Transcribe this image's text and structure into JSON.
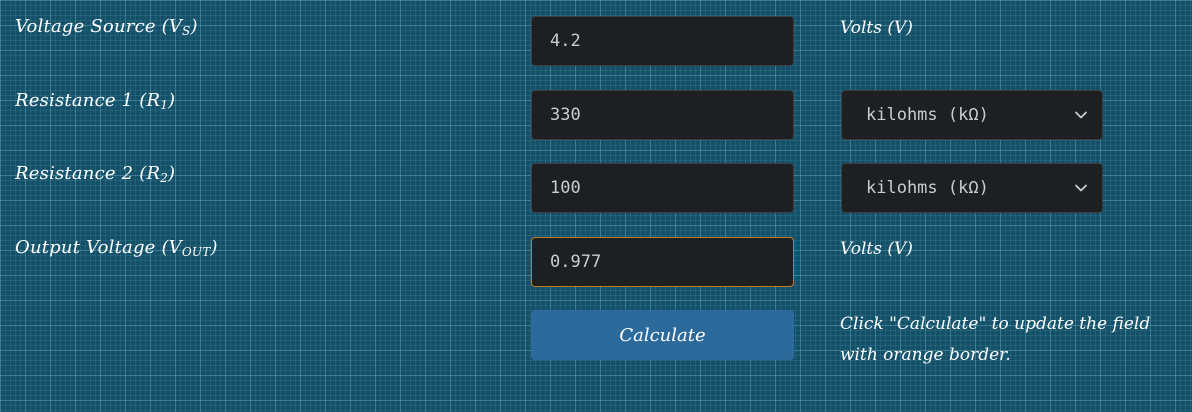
{
  "rows": {
    "voltage_source": {
      "label": "Voltage Source (V",
      "label_sub": "S",
      "label_end": ")",
      "value": "4.2",
      "unit": "Volts (V)"
    },
    "resistance1": {
      "label": "Resistance 1 (R",
      "label_sub": "1",
      "label_end": ")",
      "value": "330",
      "unit_selected": "kilohms (kΩ)"
    },
    "resistance2": {
      "label": "Resistance 2 (R",
      "label_sub": "2",
      "label_end": ")",
      "value": "100",
      "unit_selected": "kilohms (kΩ)"
    },
    "output_voltage": {
      "label": "Output Voltage (V",
      "label_sub": "OUT",
      "label_end": ")",
      "value": "0.977",
      "unit": "Volts (V)"
    }
  },
  "calculate_button": {
    "label": "Calculate"
  },
  "hint_text": "Click \"Calculate\" to update the field with orange border.",
  "colors": {
    "background": "#145068",
    "field_background": "#1d1f21",
    "output_border": "#c27a2a",
    "button": "#2d6a9c"
  }
}
